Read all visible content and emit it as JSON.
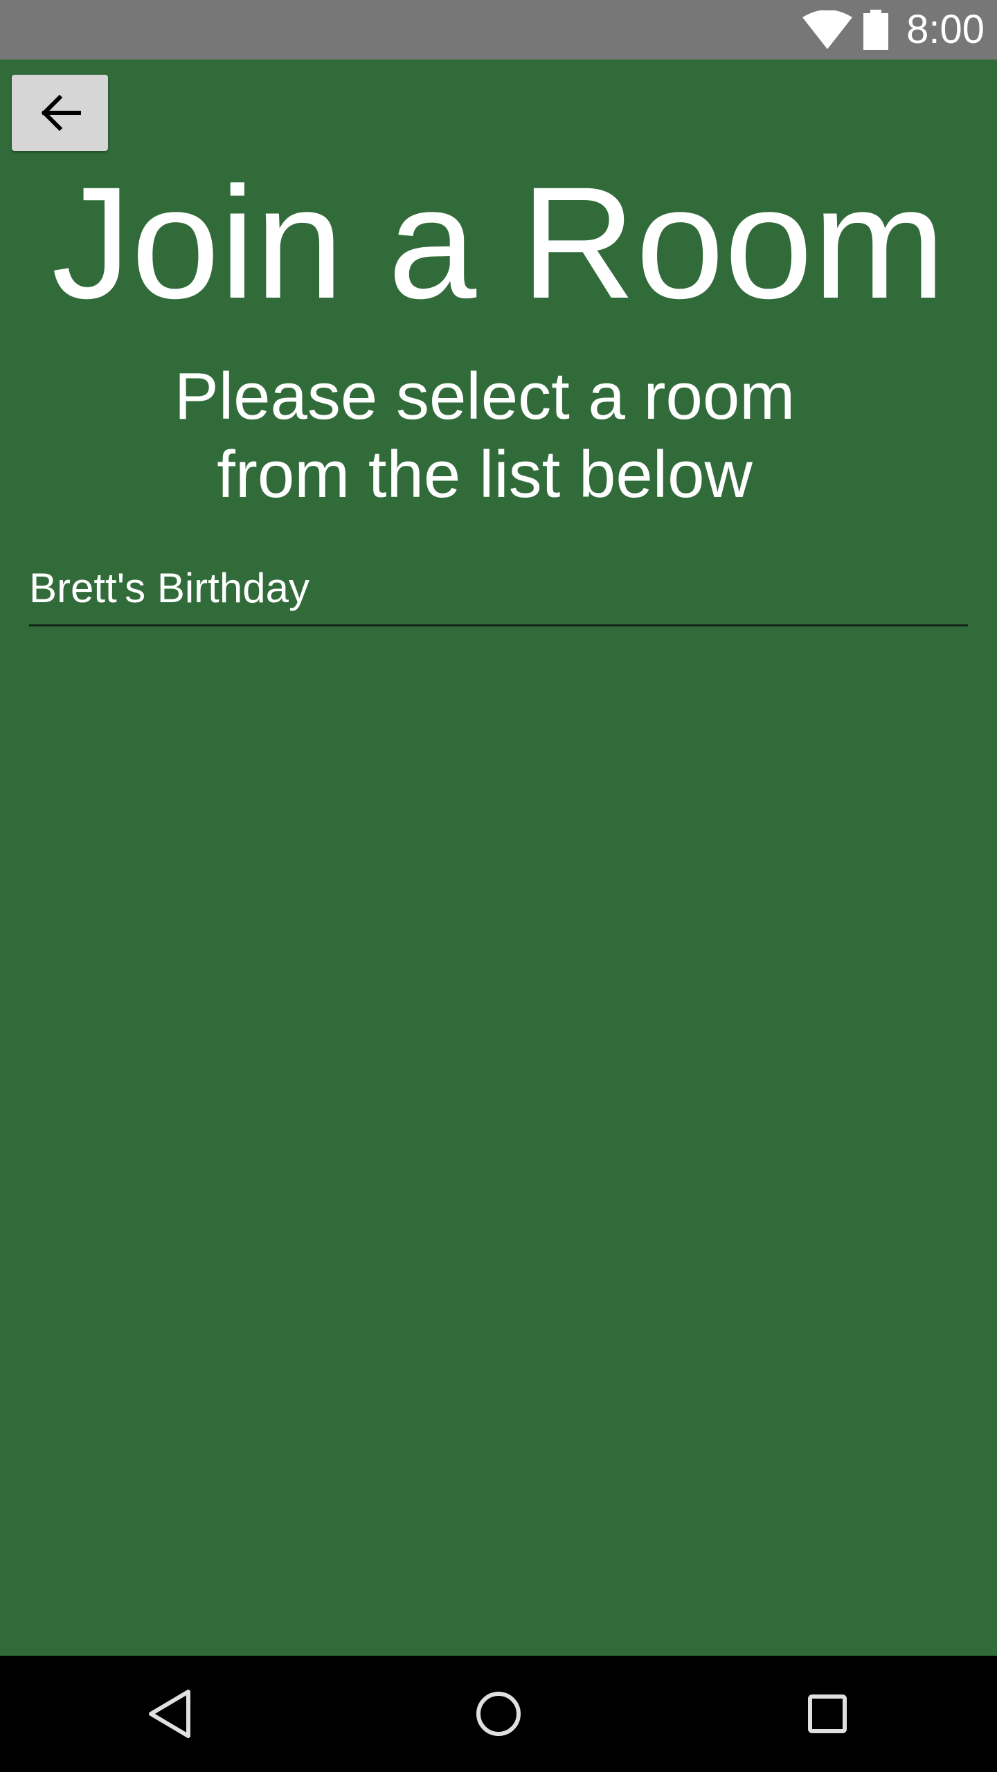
{
  "status_bar": {
    "time": "8:00",
    "icons": [
      "wifi-icon",
      "battery-icon"
    ]
  },
  "header": {
    "back_icon": "arrow-left-icon"
  },
  "main": {
    "title": "Join a Room",
    "subtitle": "Please select a room from the list below",
    "rooms": [
      {
        "name": "Brett's Birthday"
      }
    ]
  },
  "nav_bar": {
    "icons": [
      "back-triangle-icon",
      "home-circle-icon",
      "recents-square-icon"
    ]
  },
  "colors": {
    "background": "#316b3a",
    "status_bar": "#777777",
    "nav_bar": "#000000",
    "button": "#d6d6d6",
    "text": "#ffffff"
  }
}
